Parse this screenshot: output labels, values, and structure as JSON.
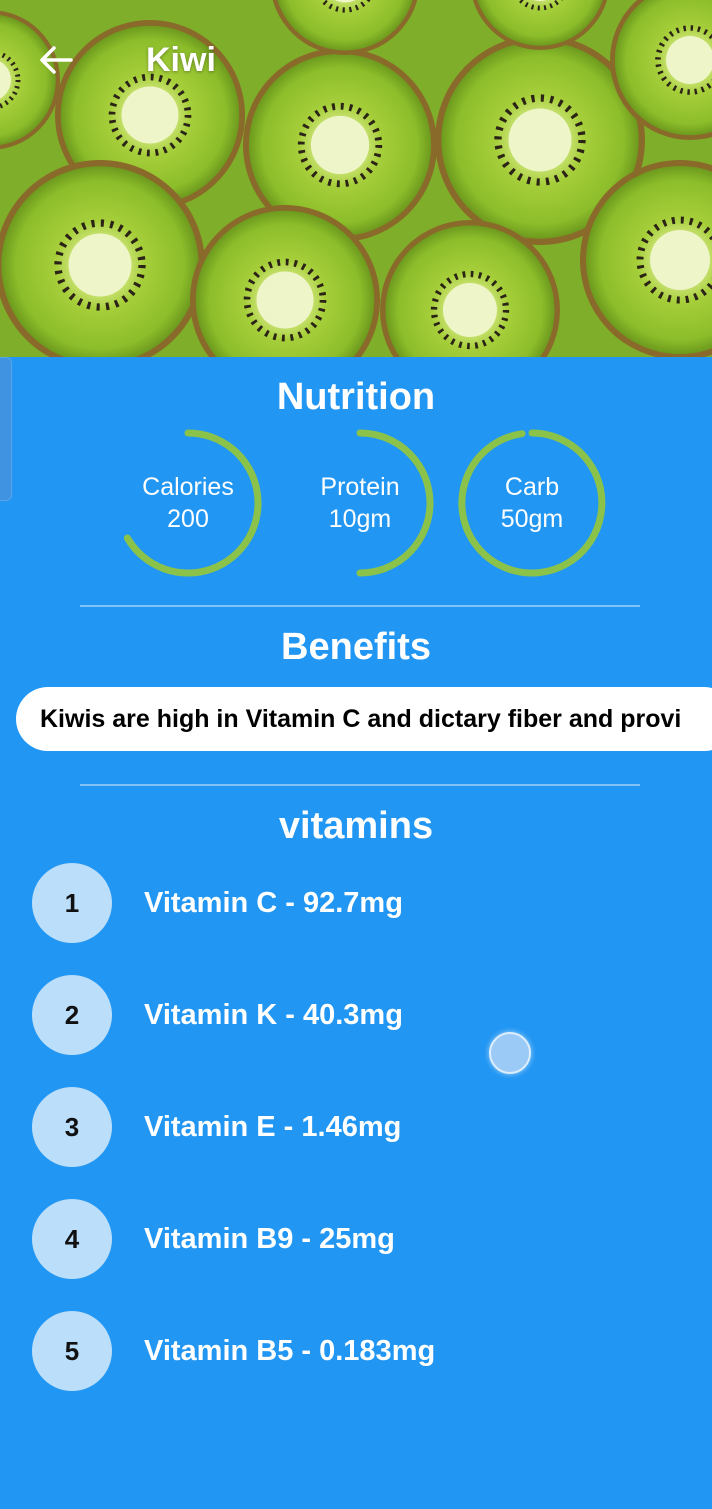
{
  "header": {
    "title": "Kiwi"
  },
  "nutrition": {
    "title": "Nutrition",
    "items": [
      {
        "label": "Calories",
        "value": "200"
      },
      {
        "label": "Protein",
        "value": "10gm"
      },
      {
        "label": "Carb",
        "value": "50gm"
      }
    ],
    "ring_color": "#8bc34a"
  },
  "benefits": {
    "title": "Benefits",
    "text": "Kiwis are high in Vitamin C and dictary fiber and provi"
  },
  "vitamins": {
    "title": "vitamins",
    "items": [
      {
        "num": "1",
        "label": "Vitamin C - 92.7mg"
      },
      {
        "num": "2",
        "label": "Vitamin K - 40.3mg"
      },
      {
        "num": "3",
        "label": "Vitamin E - 1.46mg"
      },
      {
        "num": "4",
        "label": "Vitamin B9 - 25mg"
      },
      {
        "num": "5",
        "label": "Vitamin B5 - 0.183mg"
      }
    ]
  },
  "colors": {
    "background": "#2196F3",
    "avatar": "#bbdefb"
  }
}
